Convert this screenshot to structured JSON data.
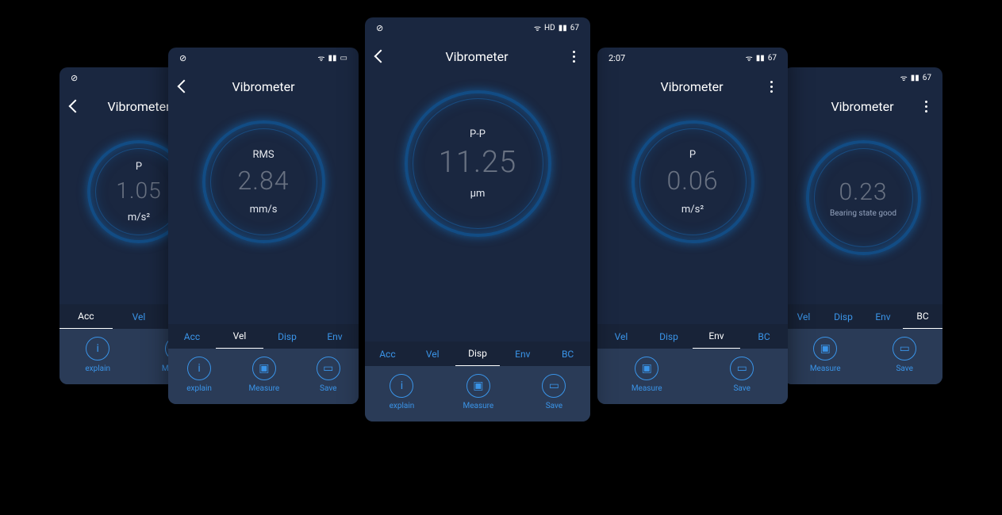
{
  "status": {
    "time": "2:07",
    "battery": "67"
  },
  "app_title": "Vibrometer",
  "tabs": {
    "acc": "Acc",
    "vel": "Vel",
    "disp": "Disp",
    "env": "Env",
    "bc": "BC"
  },
  "actions": {
    "explain": "explain",
    "measure": "Measure",
    "save": "Save"
  },
  "screens": {
    "s1": {
      "label": "P",
      "value": "1.05",
      "unit": "m/s²",
      "active": "acc"
    },
    "s2": {
      "label": "RMS",
      "value": "2.84",
      "unit": "mm/s",
      "active": "vel"
    },
    "s3": {
      "label": "P-P",
      "value": "11.25",
      "unit": "µm",
      "active": "disp"
    },
    "s4": {
      "label": "P",
      "value": "0.06",
      "unit": "m/s²",
      "active": "env"
    },
    "s5": {
      "label": "",
      "value": "0.23",
      "unit": "",
      "caption": "Bearing state good",
      "active": "bc"
    }
  }
}
